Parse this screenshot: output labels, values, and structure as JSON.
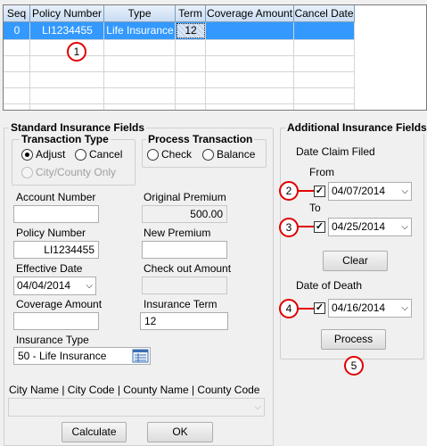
{
  "grid": {
    "columns": [
      "Seq",
      "Policy Number",
      "Type",
      "Term",
      "Coverage Amount",
      "Cancel Date"
    ],
    "row": {
      "seq": "0",
      "policy": "LI1234455",
      "type": "Life Insurance",
      "term": "12",
      "coverage": "",
      "cancel": ""
    }
  },
  "standard": {
    "title": "Standard Insurance Fields",
    "transaction_type": {
      "title": "Transaction Type",
      "adjust": "Adjust",
      "cancel": "Cancel",
      "city": "City/County Only",
      "selected": "Adjust"
    },
    "process_transaction": {
      "title": "Process Transaction",
      "check": "Check",
      "balance": "Balance"
    },
    "account_number": {
      "label": "Account Number",
      "value": ""
    },
    "original_premium": {
      "label": "Original Premium",
      "value": "500.00"
    },
    "policy_number": {
      "label": "Policy Number",
      "value": "LI1234455"
    },
    "new_premium": {
      "label": "New Premium",
      "value": ""
    },
    "effective_date": {
      "label": "Effective Date",
      "value": "04/04/2014"
    },
    "check_out_amount": {
      "label": "Check out Amount",
      "value": ""
    },
    "coverage_amount": {
      "label": "Coverage Amount",
      "value": ""
    },
    "insurance_term": {
      "label": "Insurance Term",
      "value": "12"
    },
    "insurance_type": {
      "label": "Insurance Type",
      "value": "50 - Life Insurance"
    },
    "city_label": "City Name | City Code | County Name | County Code",
    "city_value": "",
    "calculate": "Calculate",
    "ok": "OK"
  },
  "additional": {
    "title": "Additional Insurance Fields",
    "date_claim_filed": "Date Claim Filed",
    "from_label": "From",
    "from_value": "04/07/2014",
    "to_label": "To",
    "to_value": "04/25/2014",
    "clear": "Clear",
    "date_of_death_label": "Date of Death",
    "date_of_death_value": "04/16/2014",
    "process": "Process"
  },
  "callouts": [
    "1",
    "2",
    "3",
    "4",
    "5"
  ],
  "colors": {
    "selection": "#3399ff",
    "callout": "#e00000",
    "header": "#c9dcf3"
  }
}
